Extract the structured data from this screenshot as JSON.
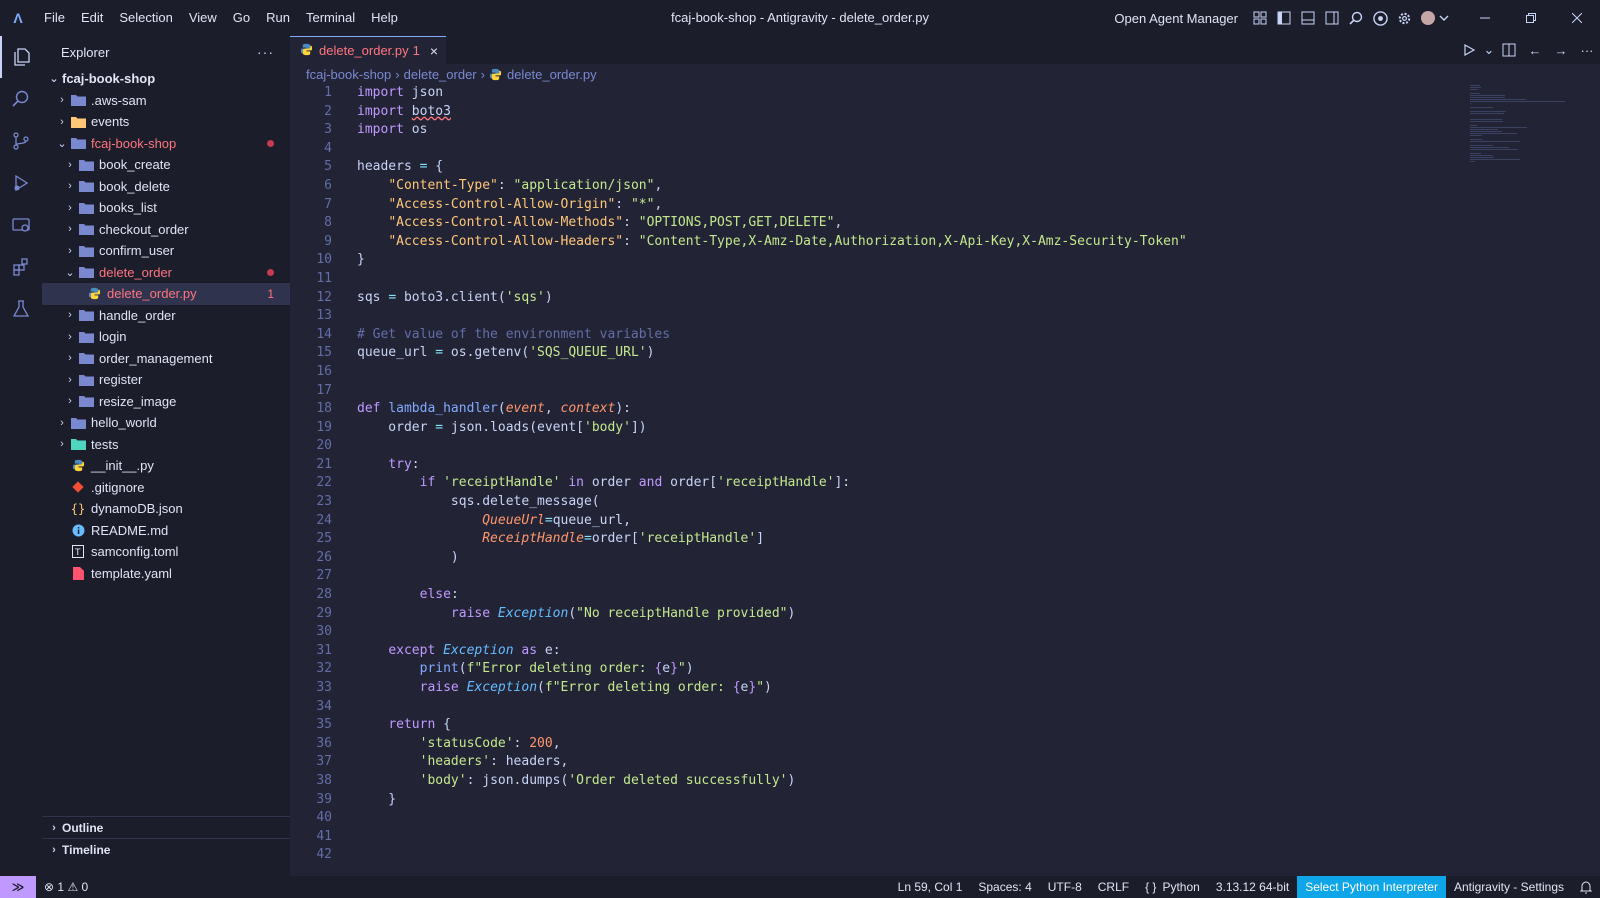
{
  "titlebar": {
    "menu": [
      "File",
      "Edit",
      "Selection",
      "View",
      "Go",
      "Run",
      "Terminal",
      "Help"
    ],
    "window_title": "fcaj-book-shop - Antigravity - delete_order.py",
    "agent_manager": "Open Agent Manager"
  },
  "sidebar": {
    "title": "Explorer",
    "more": "···",
    "root": "fcaj-book-shop",
    "items": [
      {
        "label": ".aws-sam",
        "type": "folder",
        "depth": 1,
        "open": false
      },
      {
        "label": "events",
        "type": "folder",
        "depth": 1,
        "open": false
      },
      {
        "label": "fcaj-book-shop",
        "type": "folder",
        "depth": 1,
        "open": true,
        "error": true
      },
      {
        "label": "book_create",
        "type": "folder",
        "depth": 2,
        "open": false
      },
      {
        "label": "book_delete",
        "type": "folder",
        "depth": 2,
        "open": false
      },
      {
        "label": "books_list",
        "type": "folder",
        "depth": 2,
        "open": false
      },
      {
        "label": "checkout_order",
        "type": "folder",
        "depth": 2,
        "open": false
      },
      {
        "label": "confirm_user",
        "type": "folder",
        "depth": 2,
        "open": false
      },
      {
        "label": "delete_order",
        "type": "folder",
        "depth": 2,
        "open": true,
        "error": true
      },
      {
        "label": "delete_order.py",
        "type": "python",
        "depth": 3,
        "selected": true,
        "badge": "1"
      },
      {
        "label": "handle_order",
        "type": "folder",
        "depth": 2,
        "open": false
      },
      {
        "label": "login",
        "type": "folder",
        "depth": 2,
        "open": false
      },
      {
        "label": "order_management",
        "type": "folder",
        "depth": 2,
        "open": false
      },
      {
        "label": "register",
        "type": "folder",
        "depth": 2,
        "open": false
      },
      {
        "label": "resize_image",
        "type": "folder",
        "depth": 2,
        "open": false
      },
      {
        "label": "hello_world",
        "type": "folder",
        "depth": 1,
        "open": false
      },
      {
        "label": "tests",
        "type": "folder",
        "depth": 1,
        "open": false
      },
      {
        "label": "__init__.py",
        "type": "python",
        "depth": 1
      },
      {
        "label": ".gitignore",
        "type": "git",
        "depth": 1
      },
      {
        "label": "dynamoDB.json",
        "type": "json",
        "depth": 1
      },
      {
        "label": "README.md",
        "type": "info",
        "depth": 1
      },
      {
        "label": "samconfig.toml",
        "type": "toml",
        "depth": 1
      },
      {
        "label": "template.yaml",
        "type": "yaml",
        "depth": 1
      }
    ],
    "outline": "Outline",
    "timeline": "Timeline"
  },
  "editor": {
    "tab_label": "delete_order.py",
    "tab_badge": "1",
    "breadcrumb": [
      "fcaj-book-shop",
      "delete_order",
      "delete_order.py"
    ]
  },
  "code": [
    "<span class='kw'>import</span> json",
    "<span class='kw'>import</span> <span class='squiggle'>boto3</span>",
    "<span class='kw'>import</span> os",
    "",
    "headers <span class='op'>=</span> {",
    "    <span class='key'>\"Content-Type\"</span>: <span class='str'>\"application/json\"</span>,",
    "    <span class='key'>\"Access-Control-Allow-Origin\"</span>: <span class='str'>\"*\"</span>,",
    "    <span class='key'>\"Access-Control-Allow-Methods\"</span>: <span class='str'>\"OPTIONS,POST,GET,DELETE\"</span>,",
    "    <span class='key'>\"Access-Control-Allow-Headers\"</span>: <span class='str'>\"Content-Type,X-Amz-Date,Authorization,X-Api-Key,X-Amz-Security-Token\"</span>",
    "}",
    "",
    "sqs <span class='op'>=</span> boto3.client(<span class='str'>'sqs'</span>)",
    "",
    "<span class='cmt'># Get value of the environment variables</span>",
    "queue_url <span class='op'>=</span> os.getenv(<span class='str'>'SQS_QUEUE_URL'</span>)",
    "",
    "",
    "<span class='kw'>def</span> <span class='fn'>lambda_handler</span>(<span class='param'>event</span>, <span class='param'>context</span>):",
    "    order <span class='op'>=</span> json.loads(event[<span class='str'>'body'</span>])",
    "",
    "    <span class='kw'>try</span>:",
    "        <span class='kw'>if</span> <span class='str'>'receiptHandle'</span> <span class='kw'>in</span> order <span class='kw'>and</span> order[<span class='str'>'receiptHandle'</span>]:",
    "            sqs.delete_message(",
    "                <span class='param'>QueueUrl</span><span class='op'>=</span>queue_url,",
    "                <span class='param'>ReceiptHandle</span><span class='op'>=</span>order[<span class='str'>'receiptHandle'</span>]",
    "            )",
    "",
    "        <span class='kw'>else</span>:",
    "            <span class='kw'>raise</span> <span class='cls'>Exception</span>(<span class='str'>\"No receiptHandle provided\"</span>)",
    "",
    "    <span class='kw'>except</span> <span class='cls'>Exception</span> <span class='kw'>as</span> e:",
    "        <span class='fn'>print</span>(<span class='str'>f\"Error deleting order: </span><span class='kw'>{</span>e<span class='kw'>}</span><span class='str'>\"</span>)",
    "        <span class='kw'>raise</span> <span class='cls'>Exception</span>(<span class='str'>f\"Error deleting order: </span><span class='kw'>{</span>e<span class='kw'>}</span><span class='str'>\"</span>)",
    "",
    "    <span class='kw'>return</span> {",
    "        <span class='str'>'statusCode'</span>: <span class='num'>200</span>,",
    "        <span class='str'>'headers'</span>: headers,",
    "        <span class='str'>'body'</span>: json.dumps(<span class='str'>'Order deleted successfully'</span>)",
    "    }",
    "",
    "",
    ""
  ],
  "statusbar": {
    "errors": "1",
    "warnings": "0",
    "position": "Ln 59, Col 1",
    "spaces": "Spaces: 4",
    "encoding": "UTF-8",
    "eol": "CRLF",
    "language": "Python",
    "interpreter_version": "3.13.12 64-bit",
    "select_interpreter": "Select Python Interpreter",
    "settings": "Antigravity - Settings"
  }
}
